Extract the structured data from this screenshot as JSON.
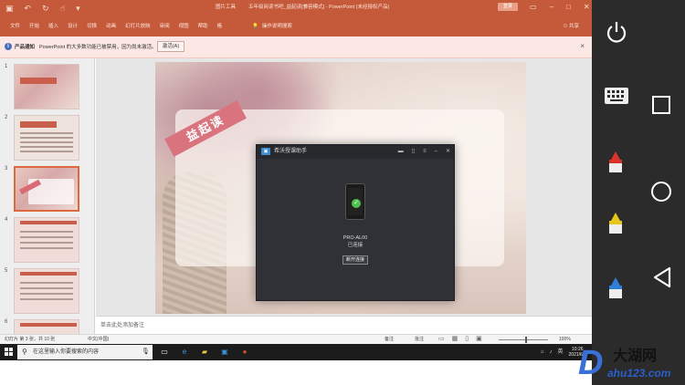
{
  "titlebar": {
    "qat_icons": [
      "save-icon",
      "undo-icon",
      "redo-icon",
      "touch-mode-icon",
      "more-icon"
    ],
    "context_tab": "图片工具",
    "doc_title": "五年级阅读书吧_益起读[兼容模式] - PowerPoint (未经授权产品)",
    "login": "登录",
    "window_controls": [
      "ribbon-display-icon",
      "minimize-icon",
      "maximize-icon",
      "close-icon"
    ]
  },
  "ribbon": {
    "tabs": [
      "文件",
      "开始",
      "插入",
      "设计",
      "切换",
      "动画",
      "幻灯片放映",
      "审阅",
      "视图",
      "帮助",
      "格"
    ],
    "tell_me": "操作说明搜索",
    "share": "共享"
  },
  "notice": {
    "title": "产品通知",
    "message": "PowerPoint 的大多数功能已被禁用，因为尚未激活。",
    "button": "激活(A)",
    "close": "×"
  },
  "thumbnails": [
    {
      "num": "1",
      "style": "text"
    },
    {
      "num": "2",
      "style": "text"
    },
    {
      "num": "3",
      "style": "photo",
      "selected": true
    },
    {
      "num": "4",
      "style": "text"
    },
    {
      "num": "5",
      "style": "text"
    },
    {
      "num": "6",
      "style": "text"
    }
  ],
  "slide": {
    "ribbon_text": "益起读"
  },
  "notes": {
    "placeholder": "单击此处添加备注"
  },
  "dialog": {
    "title": "希沃授课助手",
    "controls": [
      "folder-icon",
      "phone-icon",
      "menu-icon",
      "minimize-icon",
      "close-icon"
    ],
    "device_name": "PRO-AL00",
    "status": "已连接",
    "disconnect": "断开连接"
  },
  "statusbar": {
    "slide_info": "幻灯片 第 3 张，共 10 张",
    "language": "中文(中国)",
    "notes": "备注",
    "comments": "批注",
    "zoom": "100%",
    "zoom_fraction": 0.55
  },
  "taskbar": {
    "search_placeholder": "在这里输入你要搜索的内容",
    "apps": [
      "task-view-icon",
      "edge-icon",
      "file-explorer-icon",
      "seewo-icon",
      "powerpoint-icon"
    ],
    "time": "10:26",
    "date": "2021/6/4",
    "ime": "英"
  },
  "android": {
    "buttons": [
      "power-icon",
      "keyboard-icon",
      "recent-apps-icon",
      "home-icon",
      "back-icon"
    ],
    "markers": [
      {
        "name": "red-marker-icon",
        "color": "#d9332b"
      },
      {
        "name": "yellow-marker-icon",
        "color": "#e6c618"
      },
      {
        "name": "blue-marker-icon",
        "color": "#2f7fd6"
      }
    ]
  },
  "watermark": {
    "letter": "D",
    "name": "大湖网",
    "url": "ahu123.com"
  }
}
